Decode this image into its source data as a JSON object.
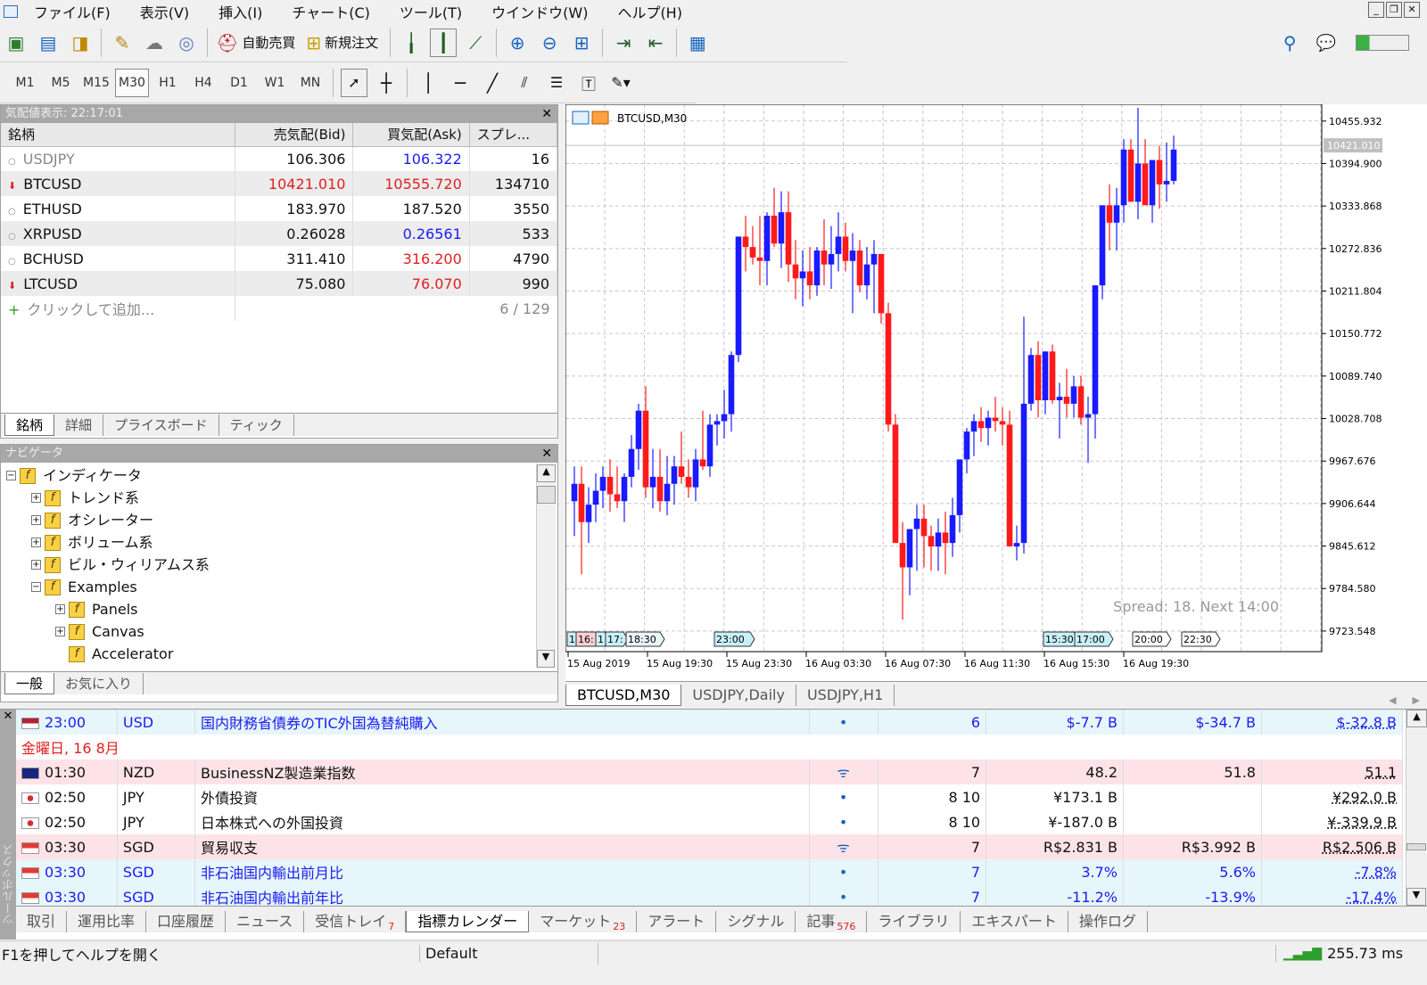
{
  "menu": {
    "items": [
      "ファイル(F)",
      "表示(V)",
      "挿入(I)",
      "チャート(C)",
      "ツール(T)",
      "ウインドウ(W)",
      "ヘルプ(H)"
    ]
  },
  "toolbar": {
    "auto_trading": "自動売買",
    "new_order": "新規注文"
  },
  "timeframes": [
    "M1",
    "M5",
    "M15",
    "M30",
    "H1",
    "H4",
    "D1",
    "W1",
    "MN"
  ],
  "active_timeframe": "M30",
  "market_watch": {
    "title": "気配値表示: 22:17:01",
    "headers": [
      "銘柄",
      "売気配(Bid)",
      "買気配(Ask)",
      "スプレ..."
    ],
    "rows": [
      {
        "symbol": "USDJPY",
        "bid": "106.306",
        "ask": "106.322",
        "spread": "16"
      },
      {
        "symbol": "BTCUSD",
        "bid": "10421.010",
        "ask": "10555.720",
        "spread": "134710"
      },
      {
        "symbol": "ETHUSD",
        "bid": "183.970",
        "ask": "187.520",
        "spread": "3550"
      },
      {
        "symbol": "XRPUSD",
        "bid": "0.26028",
        "ask": "0.26561",
        "spread": "533"
      },
      {
        "symbol": "BCHUSD",
        "bid": "311.410",
        "ask": "316.200",
        "spread": "4790"
      },
      {
        "symbol": "LTCUSD",
        "bid": "75.080",
        "ask": "76.070",
        "spread": "990"
      }
    ],
    "add_label": "クリックして追加...",
    "count": "6 / 129",
    "tabs": [
      "銘柄",
      "詳細",
      "プライスボード",
      "ティック"
    ]
  },
  "navigator": {
    "title": "ナビゲータ",
    "items": [
      "インディケータ",
      "トレンド系",
      "オシレーター",
      "ボリューム系",
      "ビル・ウィリアムス系",
      "Examples",
      "Panels",
      "Canvas",
      "Accelerator"
    ],
    "tabs": [
      "一般",
      "お気に入り"
    ]
  },
  "chart": {
    "title": "BTCUSD,M30",
    "price_labels": [
      "10455.932",
      "10394.900",
      "10333.868",
      "10272.836",
      "10211.804",
      "10150.772",
      "10089.740",
      "10028.708",
      "9967.676",
      "9906.644",
      "9845.612",
      "9784.580",
      "9723.548"
    ],
    "bid_marker": "10421.010",
    "time_labels": [
      "15 Aug 2019",
      "15 Aug 19:30",
      "15 Aug 23:30",
      "16 Aug 03:30",
      "16 Aug 07:30",
      "16 Aug 11:30",
      "16 Aug 15:30",
      "16 Aug 19:30"
    ],
    "event_markers": [
      "1",
      "16:",
      "1",
      "17:",
      "18:30",
      "23:00",
      "15:30",
      "17:00",
      "20:00",
      "22:30"
    ],
    "spread_info": "Spread: 18. Next 14:00",
    "tabs": [
      "BTCUSD,M30",
      "USDJPY,Daily",
      "USDJPY,H1"
    ]
  },
  "chart_data": {
    "type": "candlestick",
    "ylim": [
      9694,
      10480
    ],
    "candles": [
      [
        9910,
        9960,
        9860,
        9935
      ],
      [
        9935,
        9960,
        9805,
        9880
      ],
      [
        9880,
        9930,
        9850,
        9905
      ],
      [
        9905,
        9950,
        9880,
        9925
      ],
      [
        9925,
        9960,
        9900,
        9945
      ],
      [
        9945,
        9970,
        9895,
        9920
      ],
      [
        9920,
        9960,
        9900,
        9910
      ],
      [
        9910,
        9950,
        9880,
        9945
      ],
      [
        9945,
        10005,
        9930,
        9985
      ],
      [
        9985,
        10050,
        9955,
        10040
      ],
      [
        10040,
        10075,
        9915,
        9930
      ],
      [
        9930,
        9985,
        9900,
        9945
      ],
      [
        9945,
        9985,
        9895,
        9910
      ],
      [
        9910,
        9975,
        9890,
        9935
      ],
      [
        9935,
        9975,
        9905,
        9960
      ],
      [
        9960,
        10010,
        9935,
        9945
      ],
      [
        9945,
        9970,
        9915,
        9930
      ],
      [
        9930,
        9985,
        9910,
        9970
      ],
      [
        9970,
        10040,
        9955,
        9960
      ],
      [
        9960,
        10035,
        9945,
        10020
      ],
      [
        10020,
        10035,
        9990,
        10025
      ],
      [
        10025,
        10070,
        10000,
        10035
      ],
      [
        10035,
        10125,
        10010,
        10120
      ],
      [
        10120,
        10245,
        10110,
        10290
      ],
      [
        10290,
        10320,
        10240,
        10275
      ],
      [
        10275,
        10305,
        10250,
        10260
      ],
      [
        10260,
        10320,
        10220,
        10255
      ],
      [
        10255,
        10325,
        10220,
        10320
      ],
      [
        10320,
        10360,
        10275,
        10280
      ],
      [
        10280,
        10355,
        10245,
        10325
      ],
      [
        10325,
        10355,
        10225,
        10250
      ],
      [
        10250,
        10285,
        10200,
        10230
      ],
      [
        10230,
        10270,
        10190,
        10240
      ],
      [
        10240,
        10275,
        10200,
        10220
      ],
      [
        10220,
        10275,
        10205,
        10270
      ],
      [
        10270,
        10315,
        10220,
        10250
      ],
      [
        10250,
        10305,
        10215,
        10265
      ],
      [
        10265,
        10325,
        10240,
        10290
      ],
      [
        10290,
        10310,
        10240,
        10255
      ],
      [
        10255,
        10295,
        10180,
        10270
      ],
      [
        10270,
        10285,
        10210,
        10220
      ],
      [
        10220,
        10275,
        10200,
        10250
      ],
      [
        10250,
        10285,
        10180,
        10265
      ],
      [
        10265,
        10265,
        10165,
        10180
      ],
      [
        10180,
        10195,
        10010,
        10020
      ],
      [
        10020,
        10035,
        9915,
        9850
      ],
      [
        9850,
        9880,
        9740,
        9815
      ],
      [
        9815,
        9855,
        9775,
        9870
      ],
      [
        9870,
        9905,
        9810,
        9885
      ],
      [
        9885,
        9905,
        9815,
        9860
      ],
      [
        9860,
        9875,
        9810,
        9845
      ],
      [
        9845,
        9885,
        9810,
        9865
      ],
      [
        9865,
        9895,
        9805,
        9850
      ],
      [
        9850,
        9915,
        9830,
        9890
      ],
      [
        9890,
        9945,
        9865,
        9970
      ],
      [
        9970,
        10015,
        9950,
        10010
      ],
      [
        10010,
        10035,
        9975,
        10025
      ],
      [
        10025,
        10045,
        9995,
        10015
      ],
      [
        10015,
        10040,
        9990,
        10030
      ],
      [
        10030,
        10060,
        10010,
        10025
      ],
      [
        10025,
        10045,
        9990,
        10020
      ],
      [
        10020,
        10040,
        9960,
        9845
      ],
      [
        9845,
        9875,
        9825,
        9850
      ],
      [
        9850,
        10175,
        9835,
        10050
      ],
      [
        10050,
        10130,
        10040,
        10120
      ],
      [
        10120,
        10140,
        10030,
        10055
      ],
      [
        10055,
        10125,
        10035,
        10125
      ],
      [
        10125,
        10135,
        10050,
        10055
      ],
      [
        10055,
        10080,
        10000,
        10060
      ],
      [
        10060,
        10100,
        10030,
        10050
      ],
      [
        10050,
        10090,
        10030,
        10075
      ],
      [
        10075,
        10090,
        10020,
        10030
      ],
      [
        10030,
        10060,
        9965,
        10035
      ],
      [
        10035,
        10175,
        10000,
        10220
      ],
      [
        10220,
        10330,
        10200,
        10335
      ],
      [
        10335,
        10365,
        10270,
        10310
      ],
      [
        10310,
        10360,
        10270,
        10335
      ],
      [
        10335,
        10430,
        10310,
        10415
      ],
      [
        10415,
        10430,
        10370,
        10340
      ],
      [
        10340,
        10475,
        10315,
        10395
      ],
      [
        10395,
        10430,
        10345,
        10335
      ],
      [
        10335,
        10395,
        10310,
        10400
      ],
      [
        10400,
        10420,
        10330,
        10365
      ],
      [
        10365,
        10425,
        10340,
        10370
      ],
      [
        10370,
        10435,
        10365,
        10415
      ]
    ]
  },
  "calendar": {
    "day_header": "金曜日, 16 8月",
    "rows": [
      {
        "time": "23:00",
        "currency": "USD",
        "event": "国内財務省債券のTIC外国為替純購入",
        "importance": "6",
        "actual": "$-7.7 B",
        "forecast": "$-34.7 B",
        "previous": "$-32.8 B",
        "flag": "us",
        "style": "blue"
      },
      {
        "time": "01:30",
        "currency": "NZD",
        "event": "BusinessNZ製造業指数",
        "importance": "7",
        "actual": "48.2",
        "forecast": "51.8",
        "previous": "51.1",
        "flag": "nz",
        "style": "pink"
      },
      {
        "time": "02:50",
        "currency": "JPY",
        "event": "外債投資",
        "importance": "8 10",
        "actual": "¥173.1 B",
        "forecast": "",
        "previous": "¥292.0 B",
        "flag": "jp",
        "style": "plain"
      },
      {
        "time": "02:50",
        "currency": "JPY",
        "event": "日本株式への外国投資",
        "importance": "8 10",
        "actual": "¥-187.0 B",
        "forecast": "",
        "previous": "¥-339.9 B",
        "flag": "jp",
        "style": "plain"
      },
      {
        "time": "03:30",
        "currency": "SGD",
        "event": "貿易収支",
        "importance": "7",
        "actual": "R$2.831 B",
        "forecast": "R$3.992 B",
        "previous": "R$2.506 B",
        "flag": "sg",
        "style": "pink"
      },
      {
        "time": "03:30",
        "currency": "SGD",
        "event": "非石油国内輸出前月比",
        "importance": "7",
        "actual": "3.7%",
        "forecast": "5.6%",
        "previous": "-7.8%",
        "flag": "sg",
        "style": "blue"
      },
      {
        "time": "03:30",
        "currency": "SGD",
        "event": "非石油国内輸出前年比",
        "importance": "7",
        "actual": "-11.2%",
        "forecast": "-13.9%",
        "previous": "-17.4%",
        "flag": "sg",
        "style": "blue"
      }
    ]
  },
  "toolbox": {
    "side_label": "ツールボックス",
    "tabs": [
      {
        "label": "取引",
        "badge": ""
      },
      {
        "label": "運用比率",
        "badge": ""
      },
      {
        "label": "口座履歴",
        "badge": ""
      },
      {
        "label": "ニュース",
        "badge": ""
      },
      {
        "label": "受信トレイ",
        "badge": "7"
      },
      {
        "label": "指標カレンダー",
        "badge": ""
      },
      {
        "label": "マーケット",
        "badge": "23"
      },
      {
        "label": "アラート",
        "badge": ""
      },
      {
        "label": "シグナル",
        "badge": ""
      },
      {
        "label": "記事",
        "badge": "576"
      },
      {
        "label": "ライブラリ",
        "badge": ""
      },
      {
        "label": "エキスパート",
        "badge": ""
      },
      {
        "label": "操作ログ",
        "badge": ""
      }
    ],
    "active_tab": "指標カレンダー"
  },
  "status": {
    "help": "F1を押してヘルプを開く",
    "profile": "Default",
    "ping": "255.73 ms"
  },
  "colors": {
    "bull": "#1a1aff",
    "bear": "#ff1a1a",
    "grid": "#c8c8c8"
  }
}
